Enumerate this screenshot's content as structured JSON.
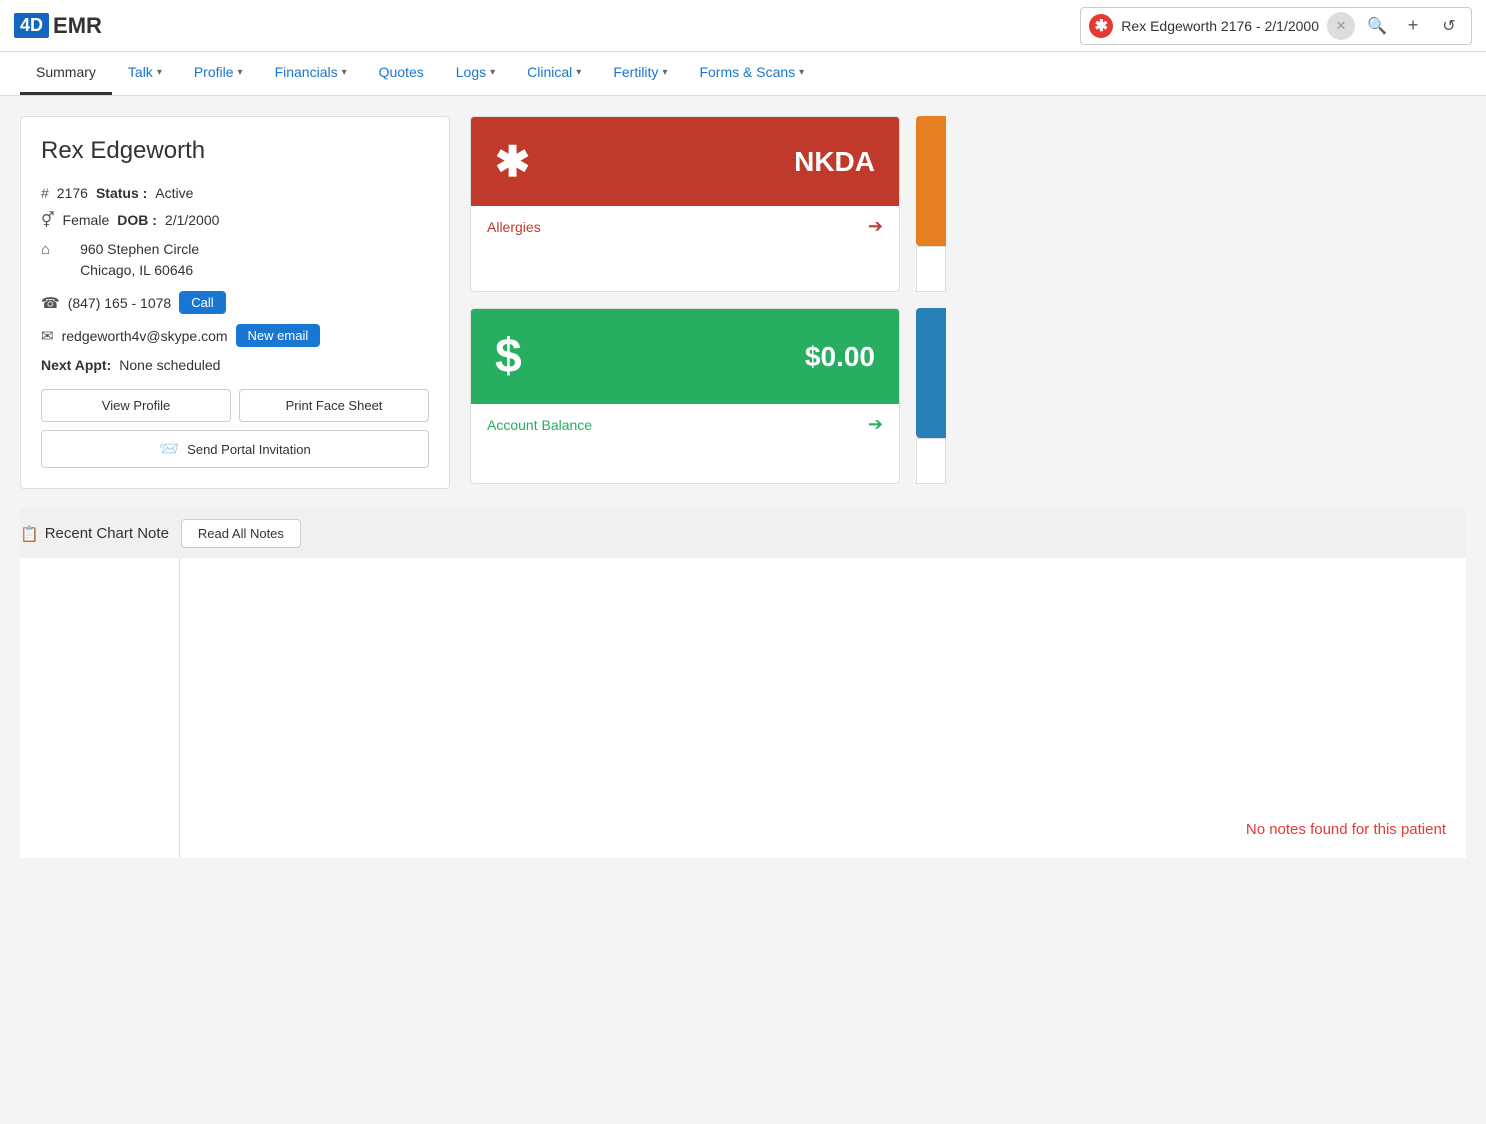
{
  "app": {
    "logo_box": "4D",
    "logo_text": "EMR"
  },
  "header": {
    "search_text": "Rex Edgeworth 2176  -  2/1/2000",
    "close_icon": "✕",
    "search_icon": "🔍",
    "plus_icon": "+",
    "history_icon": "↺"
  },
  "nav": {
    "tabs": [
      {
        "label": "Summary",
        "active": true,
        "dropdown": false
      },
      {
        "label": "Talk",
        "active": false,
        "dropdown": true
      },
      {
        "label": "Profile",
        "active": false,
        "dropdown": true
      },
      {
        "label": "Financials",
        "active": false,
        "dropdown": true
      },
      {
        "label": "Quotes",
        "active": false,
        "dropdown": false
      },
      {
        "label": "Logs",
        "active": false,
        "dropdown": true
      },
      {
        "label": "Clinical",
        "active": false,
        "dropdown": true
      },
      {
        "label": "Fertility",
        "active": false,
        "dropdown": true
      },
      {
        "label": "Forms & Scans",
        "active": false,
        "dropdown": true
      }
    ]
  },
  "patient": {
    "name": "Rex Edgeworth",
    "id": "2176",
    "status_label": "Status :",
    "status_value": "Active",
    "gender_icon": "⚥",
    "gender": "Female",
    "dob_label": "DOB :",
    "dob": "2/1/2000",
    "address_line1": "960 Stephen Circle",
    "address_line2": "Chicago, IL 60646",
    "phone": "(847) 165 - 1078",
    "call_label": "Call",
    "email": "redgeworth4v@skype.com",
    "new_email_label": "New email",
    "next_appt_label": "Next Appt:",
    "next_appt_value": "None scheduled",
    "view_profile_label": "View Profile",
    "print_face_sheet_label": "Print Face Sheet",
    "send_portal_label": "Send Portal Invitation"
  },
  "allergy": {
    "text": "NKDA",
    "footer_label": "Allergies",
    "arrow": "➔"
  },
  "balance": {
    "amount": "$0.00",
    "footer_label": "Account Balance",
    "arrow": "➔"
  },
  "chart": {
    "section_icon": "📋",
    "section_title": "Recent Chart Note",
    "read_all_label": "Read All Notes",
    "no_notes": "No notes found for this patient"
  }
}
